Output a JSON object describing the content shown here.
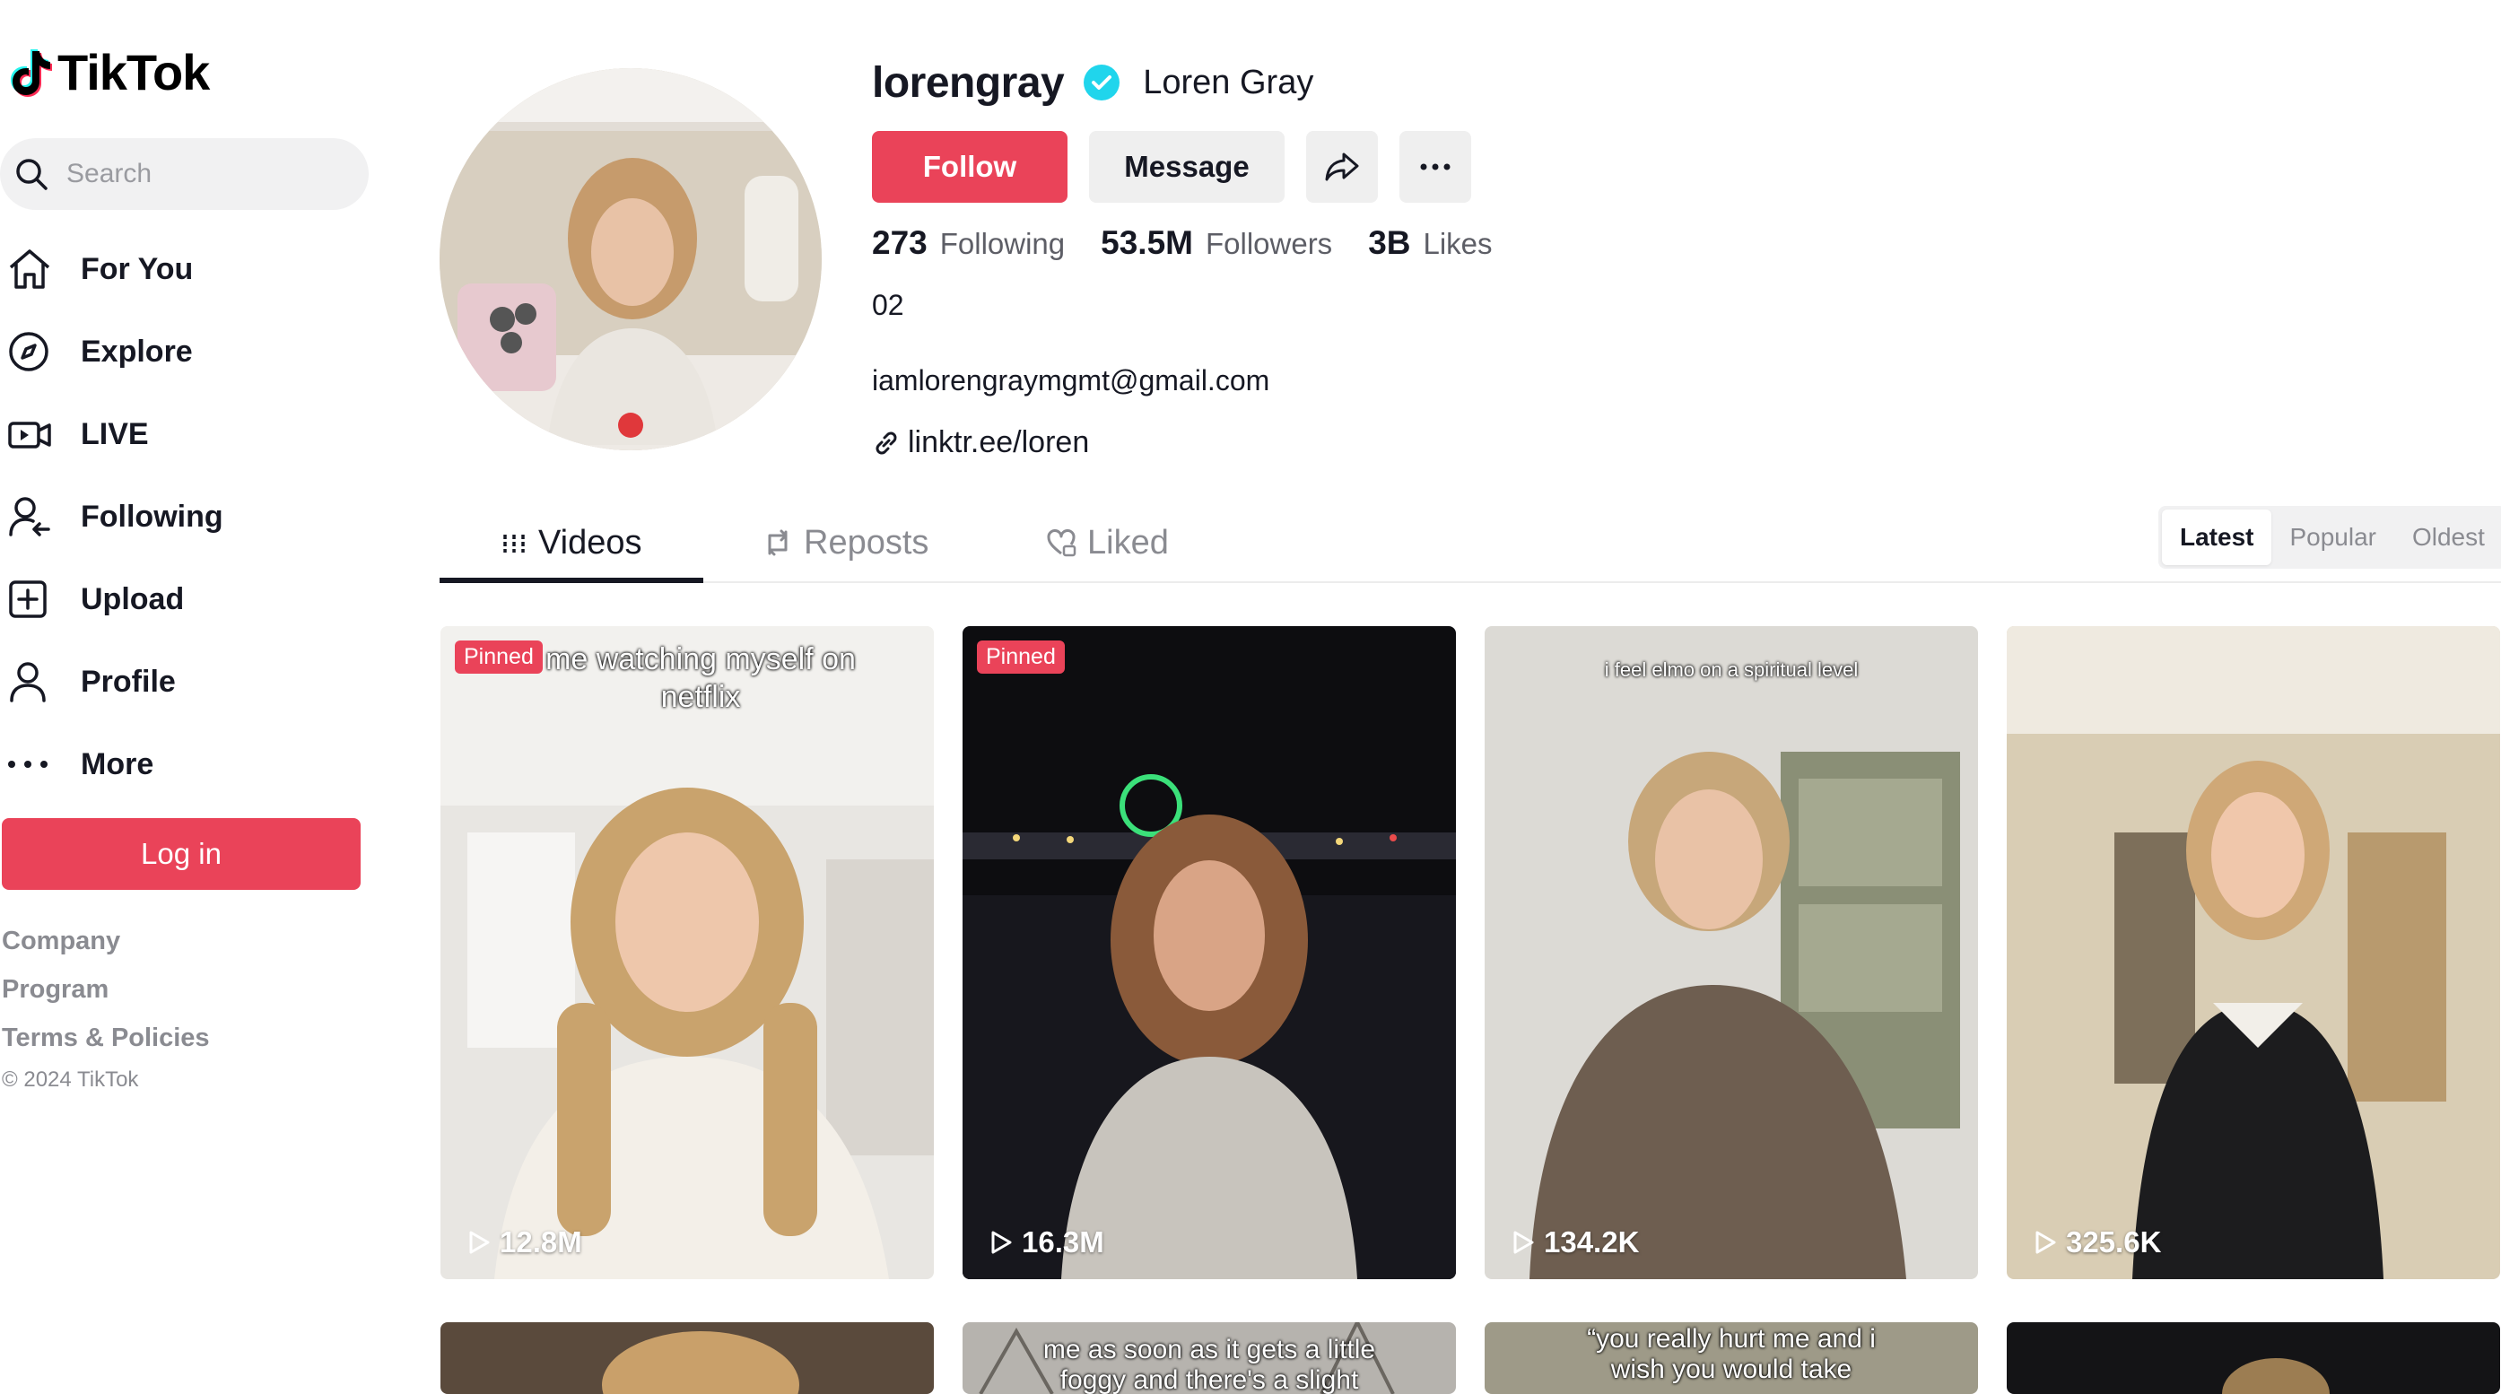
{
  "brand": {
    "name": "TikTok"
  },
  "search": {
    "placeholder": "Search"
  },
  "nav": {
    "items": [
      {
        "label": "For You",
        "icon": "home-icon"
      },
      {
        "label": "Explore",
        "icon": "compass-icon"
      },
      {
        "label": "LIVE",
        "icon": "live-video-icon"
      },
      {
        "label": "Following",
        "icon": "following-icon"
      },
      {
        "label": "Upload",
        "icon": "upload-plus-icon"
      },
      {
        "label": "Profile",
        "icon": "profile-icon"
      },
      {
        "label": "More",
        "icon": "more-dots-icon"
      }
    ]
  },
  "login": {
    "label": "Log in"
  },
  "footer": {
    "links": [
      "Company",
      "Program",
      "Terms & Policies"
    ],
    "copyright": "© 2024 TikTok"
  },
  "profile": {
    "username": "lorengray",
    "nickname": "Loren Gray",
    "verified": true,
    "follow_label": "Follow",
    "message_label": "Message",
    "stats": {
      "following": {
        "value": "273",
        "label": "Following"
      },
      "followers": {
        "value": "53.5M",
        "label": "Followers"
      },
      "likes": {
        "value": "3B",
        "label": "Likes"
      }
    },
    "bio": "02",
    "email": "iamlorengraymgmt@gmail.com",
    "link": "linktr.ee/loren"
  },
  "tabs": {
    "videos": "Videos",
    "reposts": "Reposts",
    "liked": "Liked",
    "active": "Videos"
  },
  "sort": {
    "options": [
      "Latest",
      "Popular",
      "Oldest"
    ],
    "active": "Latest"
  },
  "videos": [
    {
      "pinned": "Pinned",
      "caption": "me watching myself on netflix",
      "views": "12.8M"
    },
    {
      "pinned": "Pinned",
      "caption": "",
      "views": "16.3M"
    },
    {
      "pinned": "",
      "caption": "i feel elmo on a spiritual level",
      "views": "134.2K"
    },
    {
      "pinned": "",
      "caption": "",
      "views": "325.6K"
    }
  ],
  "videos_row2": [
    {
      "caption": ""
    },
    {
      "caption": "me as soon as it gets a little foggy and there's a slight"
    },
    {
      "caption": "“you really hurt me and i wish you would take"
    },
    {
      "caption": ""
    }
  ],
  "colors": {
    "accent": "#ea4359",
    "verified": "#20d5ec"
  }
}
